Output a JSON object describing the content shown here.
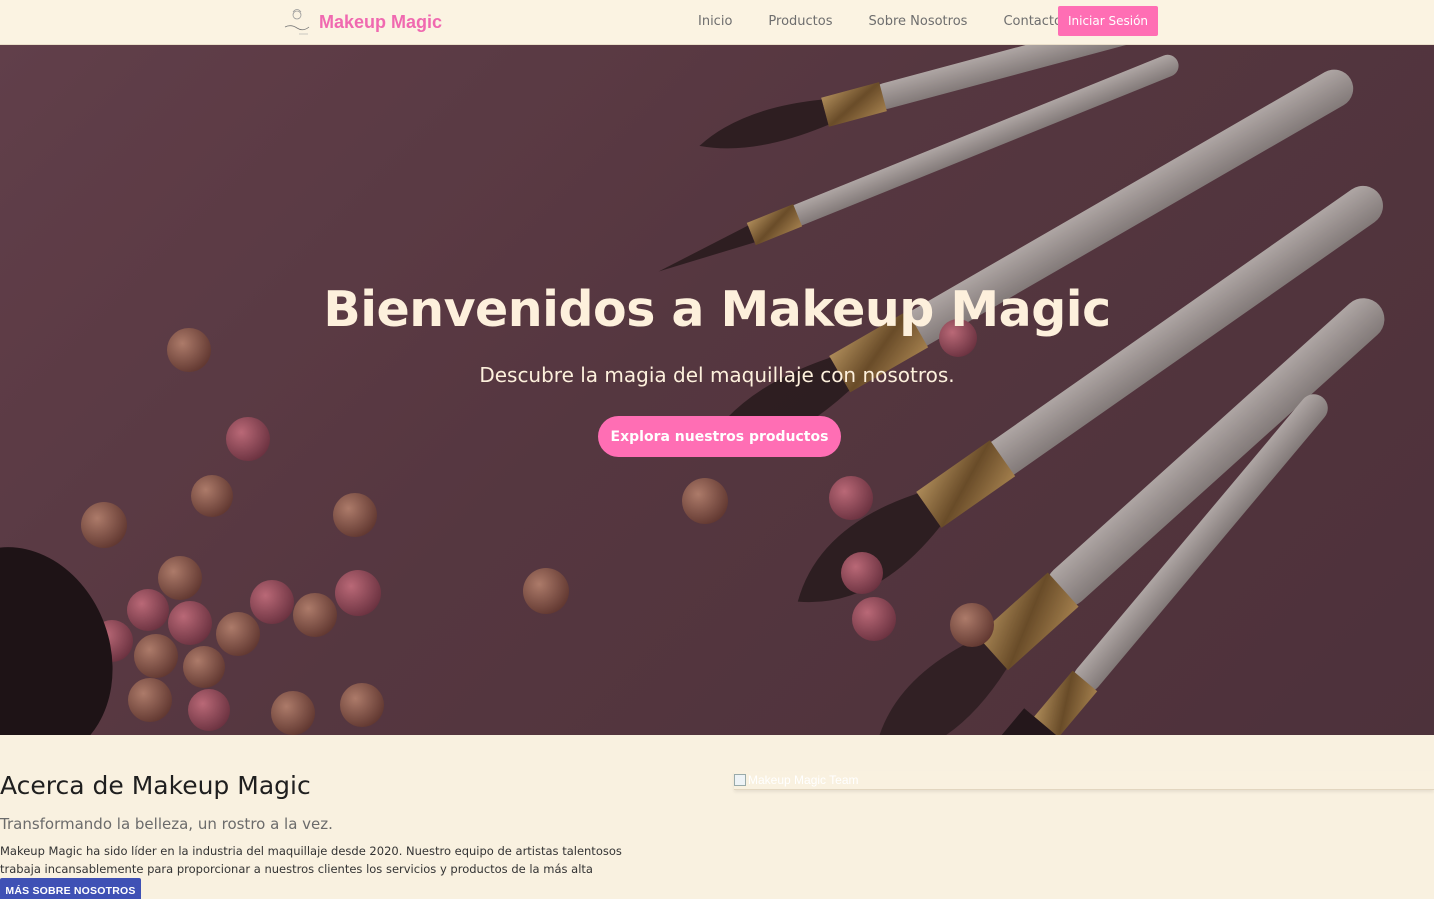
{
  "nav": {
    "brand": "Makeup Magic",
    "links": [
      "Inicio",
      "Productos",
      "Sobre Nosotros",
      "Contacto"
    ],
    "login": "Iniciar Sesión"
  },
  "hero": {
    "title": "Bienvenidos a Makeup Magic",
    "subtitle": "Descubre la magia del maquillaje con nosotros.",
    "cta": "Explora nuestros productos"
  },
  "about": {
    "title": "Acerca de Makeup Magic",
    "lead": "Transformando la belleza, un rostro a la vez.",
    "text": "Makeup Magic ha sido líder en la industria del maquillaje desde 2020. Nuestro equipo de artistas talentosos trabaja incansablemente para proporcionar a nuestros clientes los servicios y productos de la más alta calidad.",
    "button": "MÁS SOBRE NOSOTROS",
    "image_alt": "Makeup Magic Team"
  },
  "colors": {
    "accent": "#ff6eb4",
    "brand": "#f069b0",
    "background": "#f9f1e0",
    "secondary_button": "#3f51b5"
  }
}
